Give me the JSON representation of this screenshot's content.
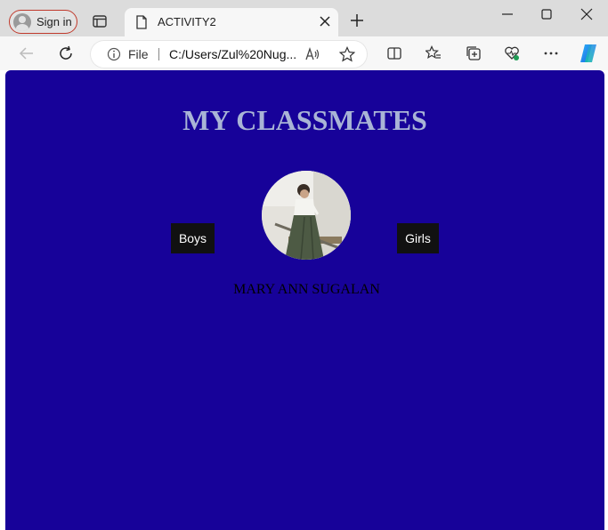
{
  "browser": {
    "signin_label": "Sign in",
    "tab_title": "ACTIVITY2",
    "address_scheme": "File",
    "address_url": "C:/Users/Zul%20Nug..."
  },
  "page": {
    "title": "MY CLASSMATES",
    "boys_button": "Boys",
    "girls_button": "Girls",
    "classmate_name": "MARY ANN SUGALAN",
    "background_color": "#170299"
  },
  "icons": [
    "person-icon",
    "tab-actions-icon",
    "page-icon",
    "close-icon",
    "plus-icon",
    "minimize-icon",
    "maximize-icon",
    "close-window-icon",
    "back-arrow-icon",
    "refresh-icon",
    "info-icon",
    "read-aloud-icon",
    "star-icon",
    "split-screen-icon",
    "favorites-icon",
    "collections-icon",
    "browser-essentials-icon",
    "more-icon",
    "copilot-icon"
  ]
}
